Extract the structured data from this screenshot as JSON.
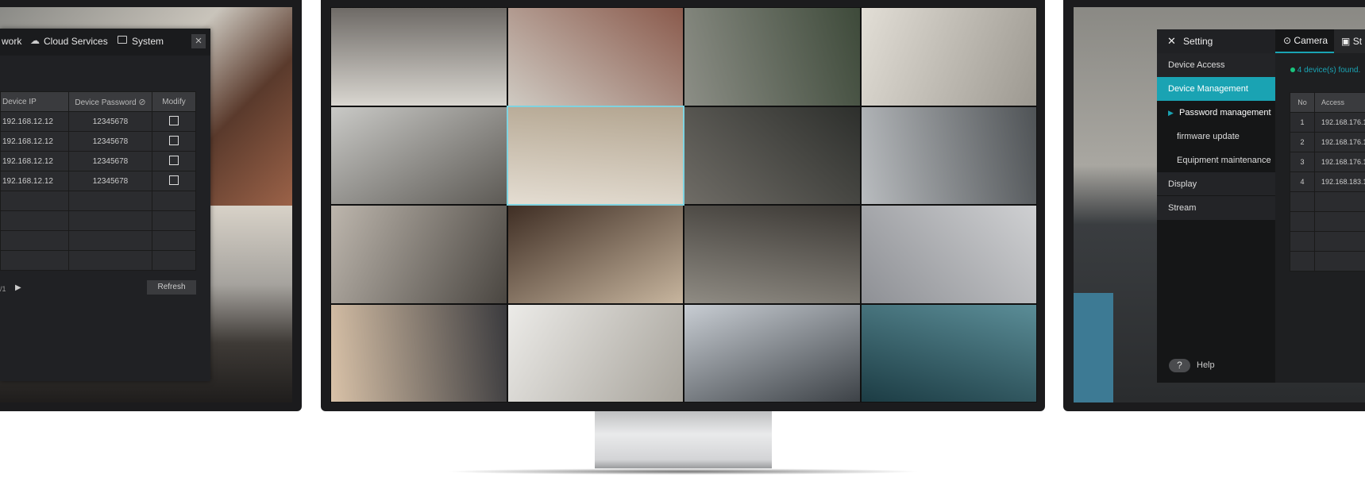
{
  "left_panel": {
    "tabs": [
      {
        "label": "work",
        "icon": "network-icon"
      },
      {
        "label": "Cloud Services",
        "icon": "cloud-icon"
      },
      {
        "label": "System",
        "icon": "monitor-icon"
      }
    ],
    "close_icon": "×",
    "table": {
      "headers": [
        "Device IP",
        "Device Password",
        "Modify"
      ],
      "rows": [
        {
          "ip": "192.168.12.12",
          "password": "12345678"
        },
        {
          "ip": "192.168.12.12",
          "password": "12345678"
        },
        {
          "ip": "192.168.12.12",
          "password": "12345678"
        },
        {
          "ip": "192.168.12.12",
          "password": "12345678"
        }
      ]
    },
    "pager": "/1",
    "next_icon": "▶",
    "refresh_label": "Refresh"
  },
  "center_monitor": {
    "grid_rows": 4,
    "grid_cols": 4,
    "selected_tile": 5,
    "selection_color": "#7fd3e0"
  },
  "right_panel": {
    "title": "Setting",
    "menu": [
      {
        "label": "Device Access"
      },
      {
        "label": "Device Management",
        "active": true
      },
      {
        "label": "Password management",
        "sub": true,
        "current": true
      },
      {
        "label": "firmware update",
        "sub": true
      },
      {
        "label": "Equipment maintenance",
        "sub": true
      },
      {
        "label": "Display"
      },
      {
        "label": "Stream"
      }
    ],
    "help_label": "Help",
    "help_icon": "?",
    "tabs": [
      {
        "label": "Camera",
        "active": true
      },
      {
        "label": "St"
      }
    ],
    "status": "4 device(s) found.",
    "table": {
      "headers": [
        "No",
        "Access"
      ],
      "rows": [
        {
          "no": "1",
          "access": "192.168.176.1"
        },
        {
          "no": "2",
          "access": "192.168.176.1"
        },
        {
          "no": "3",
          "access": "192.168.176.1"
        },
        {
          "no": "4",
          "access": "192.168.183.1"
        }
      ]
    },
    "accent_color": "#1aa3b3",
    "status_color": "#19c37d"
  }
}
